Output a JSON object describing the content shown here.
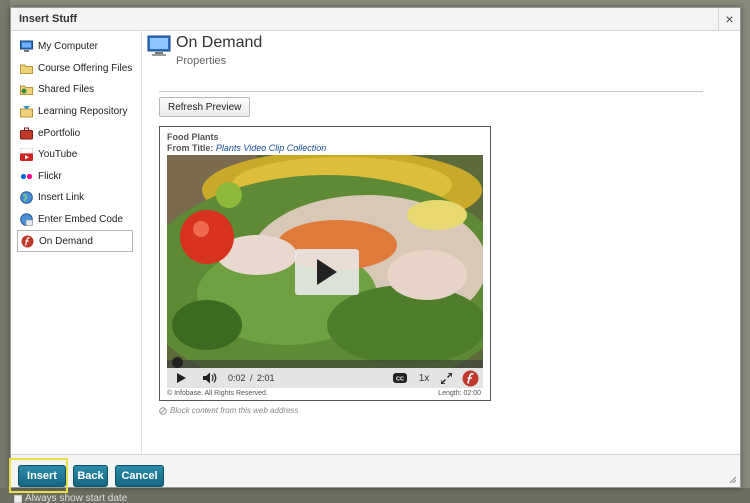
{
  "dialog": {
    "title": "Insert Stuff",
    "close_label": "×"
  },
  "sidebar": {
    "items": [
      {
        "label": "My Computer",
        "icon": "computer-icon"
      },
      {
        "label": "Course Offering Files",
        "icon": "folder-icon"
      },
      {
        "label": "Shared Files",
        "icon": "shared-files-icon"
      },
      {
        "label": "Learning Repository",
        "icon": "repository-icon"
      },
      {
        "label": "ePortfolio",
        "icon": "portfolio-icon"
      },
      {
        "label": "YouTube",
        "icon": "youtube-icon"
      },
      {
        "label": "Flickr",
        "icon": "flickr-icon"
      },
      {
        "label": "Insert Link",
        "icon": "globe-icon"
      },
      {
        "label": "Enter Embed Code",
        "icon": "embed-code-icon"
      },
      {
        "label": "On Demand",
        "icon": "on-demand-icon",
        "selected": true
      }
    ]
  },
  "main": {
    "title": "On Demand",
    "subtitle": "Properties",
    "refresh_label": "Refresh Preview",
    "embed": {
      "title": "Food Plants",
      "from_label": "From Title:",
      "from_title": "Plants Video Clip Collection",
      "time_current": "0:02",
      "time_sep": "/",
      "time_total": "2:01",
      "cc_label": "CC",
      "speed_label": "1x",
      "copyright": "© Infobase. All Rights Reserved.",
      "length_label": "Length: 02:00",
      "progress": 0.016
    },
    "block_text": "Block content from this web address"
  },
  "footer": {
    "insert_label": "Insert",
    "back_label": "Back",
    "cancel_label": "Cancel"
  },
  "background": {
    "checkbox_label": "Always show start date"
  },
  "colors": {
    "button": "#1e7a96",
    "highlight": "#e6e04a",
    "ondemand_red": "#c0392b"
  }
}
